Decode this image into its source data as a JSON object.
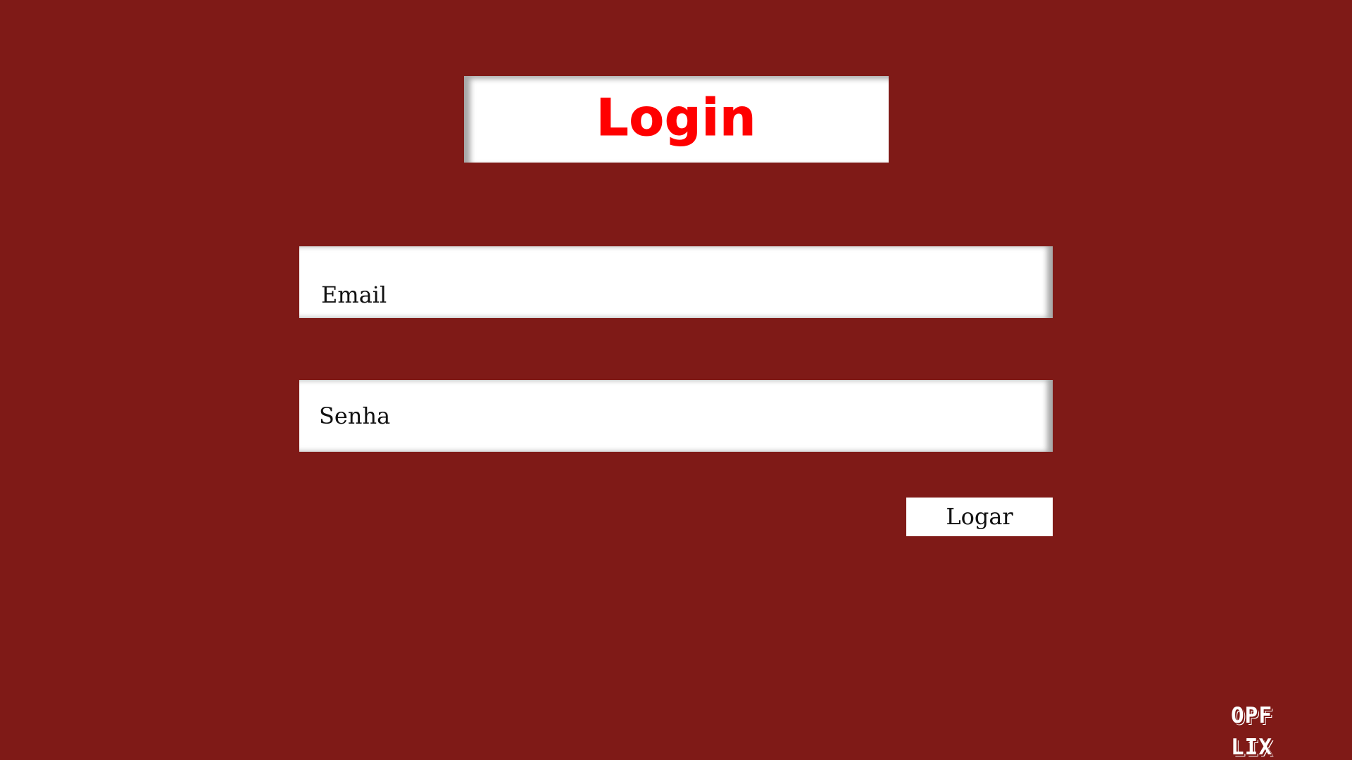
{
  "page": {
    "background_color": "#7f1a17",
    "accent_color": "#ff0000"
  },
  "header": {
    "title": "Login"
  },
  "form": {
    "email": {
      "placeholder": "Email",
      "value": ""
    },
    "password": {
      "placeholder": "Senha",
      "value": ""
    },
    "submit_label": "Logar"
  },
  "brand": {
    "line1": "OPF",
    "line2": "LIX"
  }
}
